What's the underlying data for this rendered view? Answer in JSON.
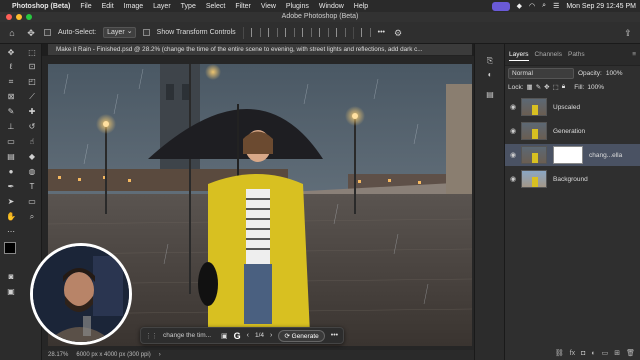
{
  "menubar": {
    "app_name": "Photoshop (Beta)",
    "items": [
      "File",
      "Edit",
      "Image",
      "Layer",
      "Type",
      "Select",
      "Filter",
      "View",
      "Plugins",
      "Window",
      "Help"
    ],
    "datetime": "Mon Sep 29  12:45 PM"
  },
  "window": {
    "title": "Adobe Photoshop (Beta)"
  },
  "options": {
    "auto_select_label": "Auto-Select:",
    "auto_select_value": "Layer",
    "show_transform_label": "Show Transform Controls",
    "more_label": "•••"
  },
  "document": {
    "tab_title": "Make it Rain - Finished.psd @ 28.2% (change the time of the entire scene to evening, with street lights and reflections, add dark c...",
    "zoom": "28.17%",
    "size_info": "6000 px x 4000 px (300 ppi)"
  },
  "taskbar": {
    "prompt": "change the tim...",
    "page": "1/4",
    "generate_label": "Generate",
    "more_label": "•••"
  },
  "layers_panel": {
    "tabs": [
      "Layers",
      "Channels",
      "Paths"
    ],
    "active_tab": "Layers",
    "blend_mode": "Normal",
    "opacity_label": "Opacity:",
    "opacity_value": "100%",
    "lock_label": "Lock:",
    "fill_label": "Fill:",
    "fill_value": "100%",
    "layers": [
      {
        "name": "Upscaled",
        "selected": false
      },
      {
        "name": "Generation",
        "selected": false
      },
      {
        "name": "chang...ella",
        "selected": true
      },
      {
        "name": "Background",
        "selected": false
      }
    ],
    "bottom_icons": [
      "link-icon",
      "fx-icon",
      "mask-icon",
      "adjustment-icon",
      "group-icon",
      "new-layer-icon",
      "trash-icon"
    ]
  },
  "colors": {
    "accent_menu_pill": "#6a5ad8",
    "selected_layer": "#4a5263",
    "raincoat": "#d8c021"
  }
}
